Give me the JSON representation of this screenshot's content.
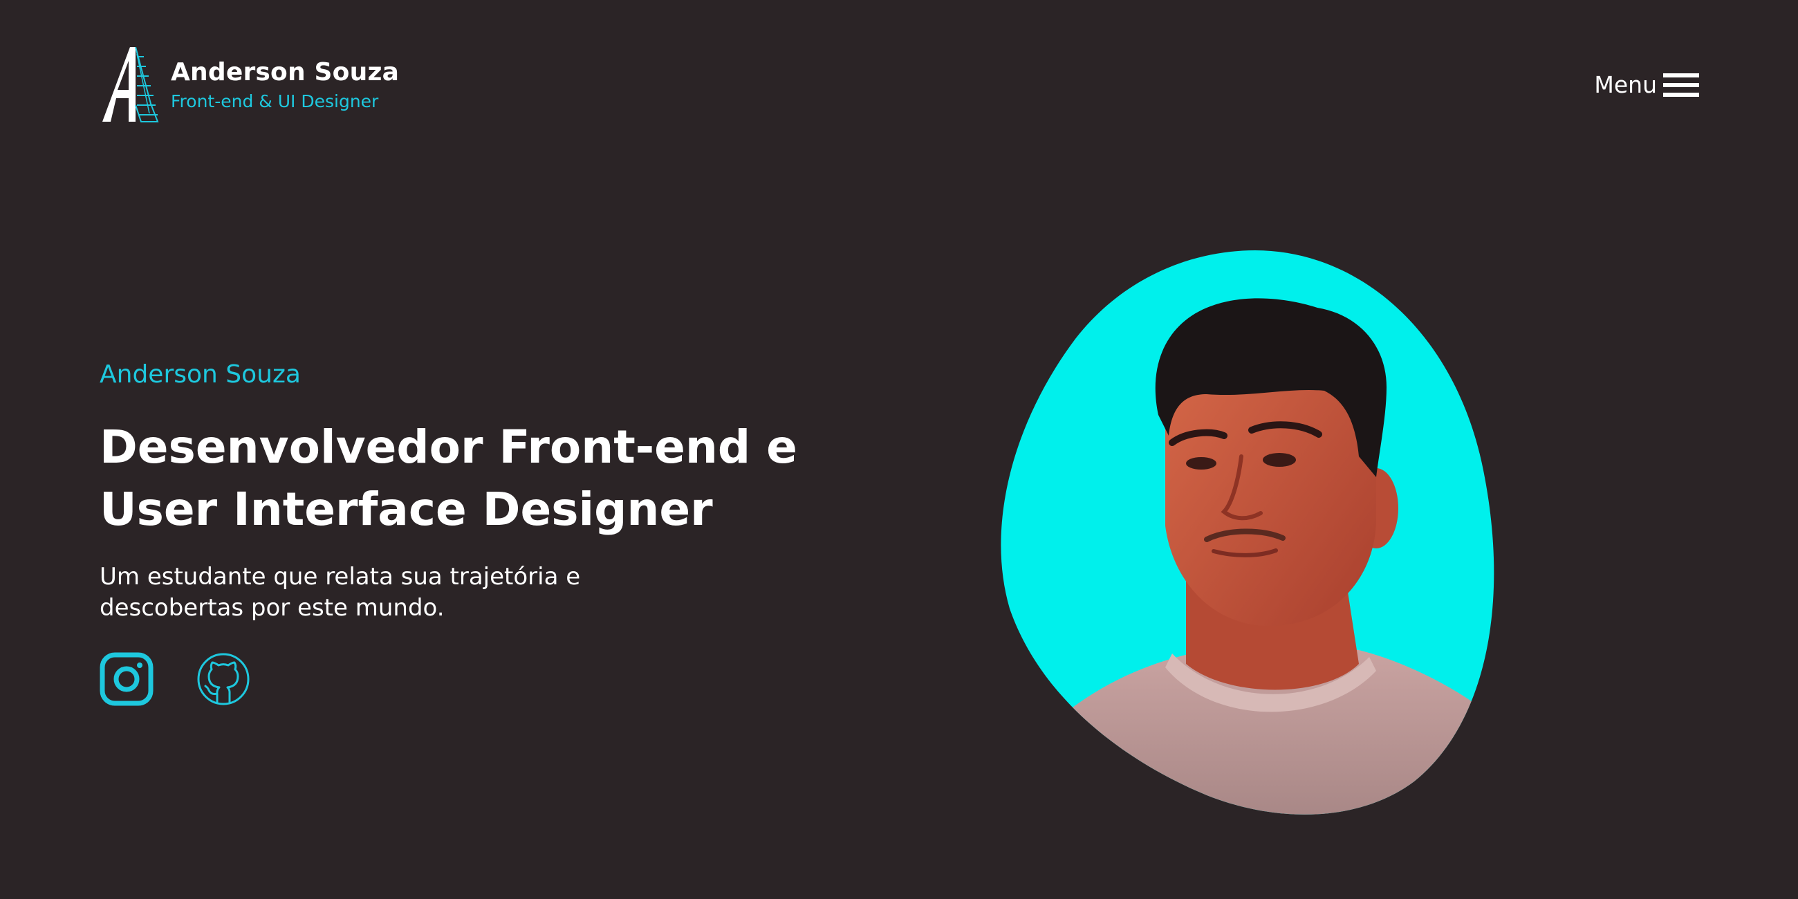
{
  "header": {
    "logo_icon": "letter-a-logo",
    "brand_name": "Anderson Souza",
    "brand_role": "Front-end & UI Designer",
    "menu_label": "Menu",
    "menu_icon": "hamburger-icon"
  },
  "hero": {
    "name": "Anderson Souza",
    "title_line1": "Desenvolvedor Front-end e",
    "title_line2": "User Interface Designer",
    "description_line1": "Um estudante que relata sua trajetória e",
    "description_line2": "descobertas por este mundo."
  },
  "socials": [
    {
      "icon": "instagram-icon"
    },
    {
      "icon": "github-icon"
    }
  ],
  "colors": {
    "background": "#2b2426",
    "accent": "#1ec8de",
    "portrait_bg": "#00f0ec",
    "text": "#ffffff"
  }
}
